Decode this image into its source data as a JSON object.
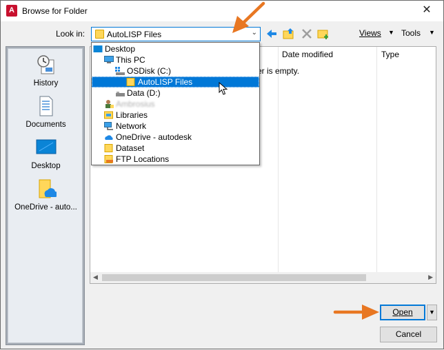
{
  "window": {
    "title": "Browse for Folder",
    "close_glyph": "✕",
    "app_icon_letter": "A"
  },
  "toolbar": {
    "look_in_label": "Look in:",
    "look_in_value": "AutoLISP Files",
    "views_label": "Views",
    "tools_label": "Tools",
    "icons": [
      "back-arrow-icon",
      "up-folder-icon",
      "delete-icon",
      "new-folder-icon"
    ]
  },
  "places": [
    {
      "label": "History",
      "icon": "history-icon"
    },
    {
      "label": "Documents",
      "icon": "documents-icon"
    },
    {
      "label": "Desktop",
      "icon": "desktop-icon"
    },
    {
      "label": "OneDrive - auto...",
      "icon": "onedrive-folder-icon"
    }
  ],
  "file_list": {
    "columns": [
      "Date modified",
      "Type"
    ],
    "empty_message": "er is empty."
  },
  "lookin_dropdown": {
    "items": [
      {
        "label": "Desktop",
        "icon": "desktop-icon",
        "indent": 0
      },
      {
        "label": "This PC",
        "icon": "computer-icon",
        "indent": 1
      },
      {
        "label": "OSDisk (C:)",
        "icon": "drive-icon",
        "indent": 2
      },
      {
        "label": "AutoLISP Files",
        "icon": "folder-icon",
        "indent": 3,
        "selected": true
      },
      {
        "label": "Data (D:)",
        "icon": "drive-icon",
        "indent": 2
      },
      {
        "label": "Ambrosius",
        "icon": "user-folder-icon",
        "indent": 1,
        "blurred": true
      },
      {
        "label": "Libraries",
        "icon": "libraries-icon",
        "indent": 1
      },
      {
        "label": "Network",
        "icon": "network-icon",
        "indent": 1
      },
      {
        "label": "OneDrive - autodesk",
        "icon": "onedrive-icon",
        "indent": 1
      },
      {
        "label": "Dataset",
        "icon": "folder-icon",
        "indent": 1
      },
      {
        "label": "FTP Locations",
        "icon": "ftp-folder-icon",
        "indent": 1
      }
    ]
  },
  "buttons": {
    "open_label": "Open",
    "cancel_label": "Cancel"
  },
  "colors": {
    "selection": "#0078d7",
    "annotation_arrow": "#e87722",
    "folder_yellow": "#ffd75a"
  }
}
